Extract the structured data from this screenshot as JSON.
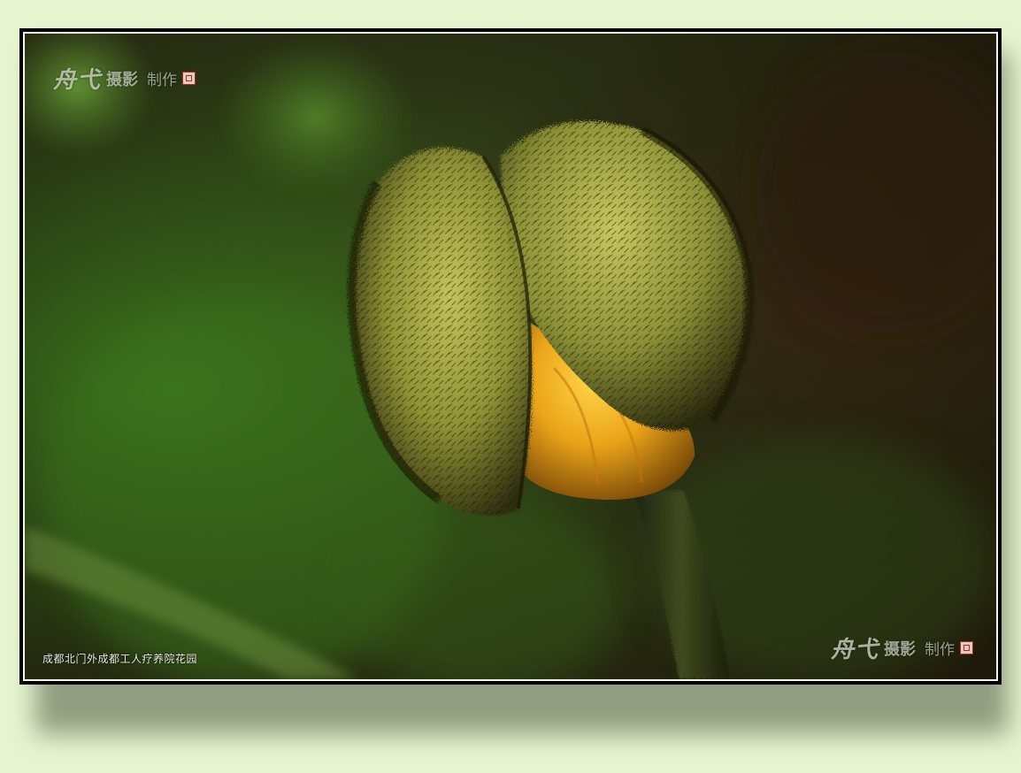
{
  "photo": {
    "subject_icon": "poppy-bud-icon",
    "background_color": "#e6f5cf",
    "accent_yellow": "#f0b21c",
    "bud_green": "#a8b04a"
  },
  "watermark_top": {
    "signature": "舟弋",
    "word1": "摄影",
    "word2": "制作"
  },
  "watermark_bottom": {
    "signature": "舟弋",
    "word1": "摄影",
    "word2": "制作"
  },
  "caption": {
    "text": "成都北门外成都工人疗养院花园"
  }
}
